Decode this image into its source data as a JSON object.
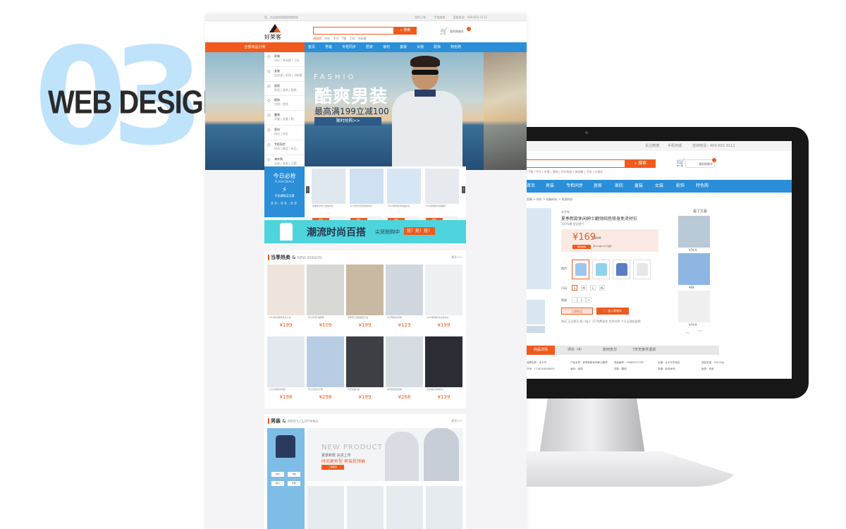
{
  "badge": {
    "digits_left": "0",
    "digits_right": "3",
    "title": "WEB DESIGN"
  },
  "colors": {
    "accent": "#f05a1c",
    "nav_blue": "#2a8ed9",
    "promo_cyan": "#4ed4dc",
    "badge_blue": "#bfe3fb"
  },
  "store": {
    "topbar": {
      "welcome": "您，欢迎来到智能购物商城",
      "links": [
        "我的订单",
        "手机商城",
        "客服热线：400-602-3112"
      ]
    },
    "logo_text": "好莱客",
    "search": {
      "button": "搜索",
      "hot": [
        "热搜榜",
        "衬衫",
        "牛仔",
        "T恤",
        "卫衣",
        "休闲裤"
      ]
    },
    "cart_label": "我的购物车",
    "nav": {
      "category": "全部商品分类",
      "items": [
        "首页",
        "男装",
        "专柜同步",
        "居家",
        "家纺",
        "童装",
        "女装",
        "配饰",
        "特色购"
      ]
    },
    "sidebar": [
      {
        "icon": "tshirt-icon",
        "title": "男装",
        "sub": "衬衫 | 休闲裤 | 卫衣"
      },
      {
        "icon": "dress-icon",
        "title": "女装",
        "sub": "连衣裙 | 毛呢 | 羽绒服"
      },
      {
        "icon": "home-icon",
        "title": "居家",
        "sub": "家居 | 收纳 | 厨具"
      },
      {
        "icon": "bag-icon",
        "title": "配饰",
        "sub": "包袋 | 首饰"
      },
      {
        "icon": "child-icon",
        "title": "童装",
        "sub": "男童 | 女童 | 鞋"
      },
      {
        "icon": "bed-icon",
        "title": "家纺",
        "sub": "床品 | 布艺"
      },
      {
        "icon": "gift-icon",
        "title": "专柜同步",
        "sub": "时尚 | 精品 | 新品"
      },
      {
        "icon": "star-icon",
        "title": "海外购",
        "sub": "全球 | 直邮 | 品牌"
      }
    ],
    "banner": {
      "eyebrow": "FASHIO",
      "title": "酷爽男装",
      "subtitle": "最高满199立减100",
      "button": "限时抢购>>"
    },
    "flash": {
      "title": "今日必抢",
      "subtitle": "FLASH DEALS",
      "note": "手机端购买优惠",
      "clock": "00:00:00",
      "products": [
        {
          "caption": "夏季新款男士短袖T恤",
          "price": "¥99"
        },
        {
          "caption": "2018新款男装纯棉衬衫",
          "price": "¥99"
        },
        {
          "caption": "2018夏季新款短袖衬衫",
          "price": "¥99"
        },
        {
          "caption": "2018夏季新款阔腿裤",
          "price": "¥99"
        }
      ]
    },
    "promo": {
      "title": "潮流时尚百搭",
      "sub": "尖货抢购中",
      "button": "抢！抢！抢！"
    },
    "season": {
      "title": "当季热卖",
      "en": "NEW SEASON",
      "more": "更多>>",
      "products": [
        {
          "caption": "2018新款夏季雪纺上衣",
          "price": "¥199"
        },
        {
          "caption": "男士休闲T恤纯棉",
          "price": "¥109"
        },
        {
          "caption": "夏季男士短袖圆领T恤",
          "price": "¥199"
        },
        {
          "caption": "牛仔短裤女夏季",
          "price": "¥129"
        },
        {
          "caption": "2018夏季新款白色衬衫",
          "price": "¥199"
        },
        {
          "caption": "九分长裤修身男装",
          "price": "¥198"
        },
        {
          "caption": "男士直筒牛仔裤",
          "price": "¥298"
        },
        {
          "caption": "印花短袖T恤",
          "price": "¥199"
        },
        {
          "caption": "休闲套装男夏季",
          "price": "¥268"
        },
        {
          "caption": "连衣裙女夏季新款",
          "price": "¥139"
        }
      ]
    },
    "mens": {
      "title": "男装",
      "en": "MEN'S CLOTHING",
      "more": "更多>>",
      "tags": [
        "衬衫",
        "T恤",
        "裤子",
        "外套"
      ],
      "new_product": {
        "title": "NEW PRODUCT",
        "line1": "夏季新款 尖货上市",
        "line2": "时尚更有型 男装我领袖",
        "button": "了解更多"
      }
    }
  },
  "detail": {
    "topbar": [
      "关注微博",
      "手机商城",
      "咨询电话：400-602-3112"
    ],
    "search": {
      "button": "搜索",
      "hot": "| T恤 | 牛仔 | 外套 | 夏装 | 衬衫热卖 | 休闲裤 | 卫衣 | 红裙衫"
    },
    "cart_label": "我的购物车",
    "nav": [
      "首页",
      "男装",
      "专柜同步",
      "居家",
      "家纺",
      "童装",
      "女装",
      "配饰",
      "特色购"
    ],
    "breadcrumb": "男装 > 衬衫 > 短袖衬衫 > 免烫衬衫",
    "brand": "太平鸟",
    "title": "夏季新款休闲绅士翻领纯色修身免烫衬衫",
    "subtitle": "100%棉  舒适透气",
    "price": "¥169",
    "old_price": "¥298",
    "price_tag": "限时抢购",
    "price_tag_note": "满199减100元包邮",
    "color_label": "颜色",
    "size_label": "尺码",
    "sizes": [
      "S",
      "M",
      "L",
      "XL"
    ],
    "qty_label": "数量",
    "qty": "1",
    "buy_button": "立即购买",
    "cart_button": "加入购物车",
    "promise": "承诺   正品保证  假一赔十  12 免费退货  货到付款  七天无理由退换",
    "tabs": [
      "商品详情",
      "评价（4）",
      "如何支付",
      "7天无条件退货"
    ],
    "attrs": [
      "品牌名称：太平鸟",
      "产品名称：夏季新款休闲绅士翻领",
      "商品编号：29685572765",
      "店铺：太平鸟专卖店",
      "商品毛重：500.00g",
      "货号：1218305648625",
      "面料：纯棉",
      "领型：翻领",
      "风格：商务休闲",
      "版型：修身"
    ],
    "seen_title": "看了又看",
    "seen_prices": [
      "¥79.9",
      "¥68",
      "¥79.9"
    ]
  }
}
